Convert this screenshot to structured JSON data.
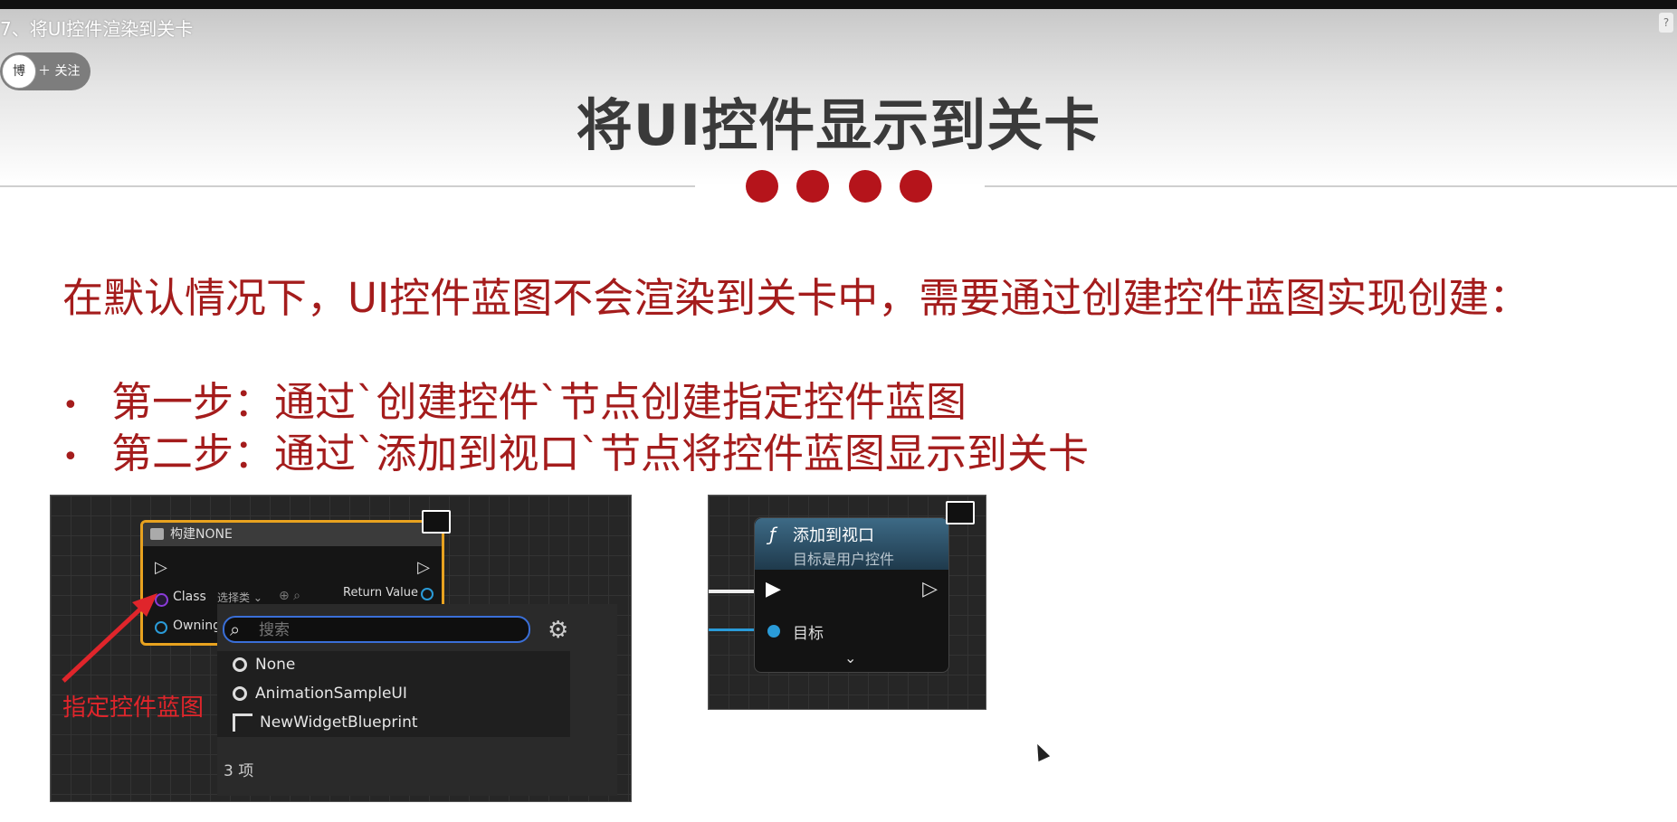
{
  "video": {
    "title": "7、将UI控件渲染到关卡"
  },
  "follow": {
    "label": "＋ 关注",
    "avatar_text": "博"
  },
  "slide": {
    "title": "将UI控件显示到关卡",
    "intro": "在默认情况下，UI控件蓝图不会渲染到关卡中，需要通过创建控件蓝图实现创建：",
    "bullets": [
      "第一步：通过`创建控件`节点创建指定控件蓝图",
      "第二步：通过`添加到视口`节点将控件蓝图显示到关卡"
    ],
    "accent_color": "#b5141b"
  },
  "screenshot1": {
    "node_title": "构建NONE",
    "class_pin": "Class",
    "class_select": "选择类 ⌄",
    "return_pin": "Return Value",
    "owning_pin": "Owning",
    "search_placeholder": "搜索",
    "items": [
      "None",
      "AnimationSampleUI",
      "NewWidgetBlueprint"
    ],
    "count": "3 项",
    "annotation": "指定控件蓝图"
  },
  "screenshot2": {
    "node_title": "添加到视口",
    "node_subtitle": "目标是用户控件",
    "target_pin": "目标"
  }
}
